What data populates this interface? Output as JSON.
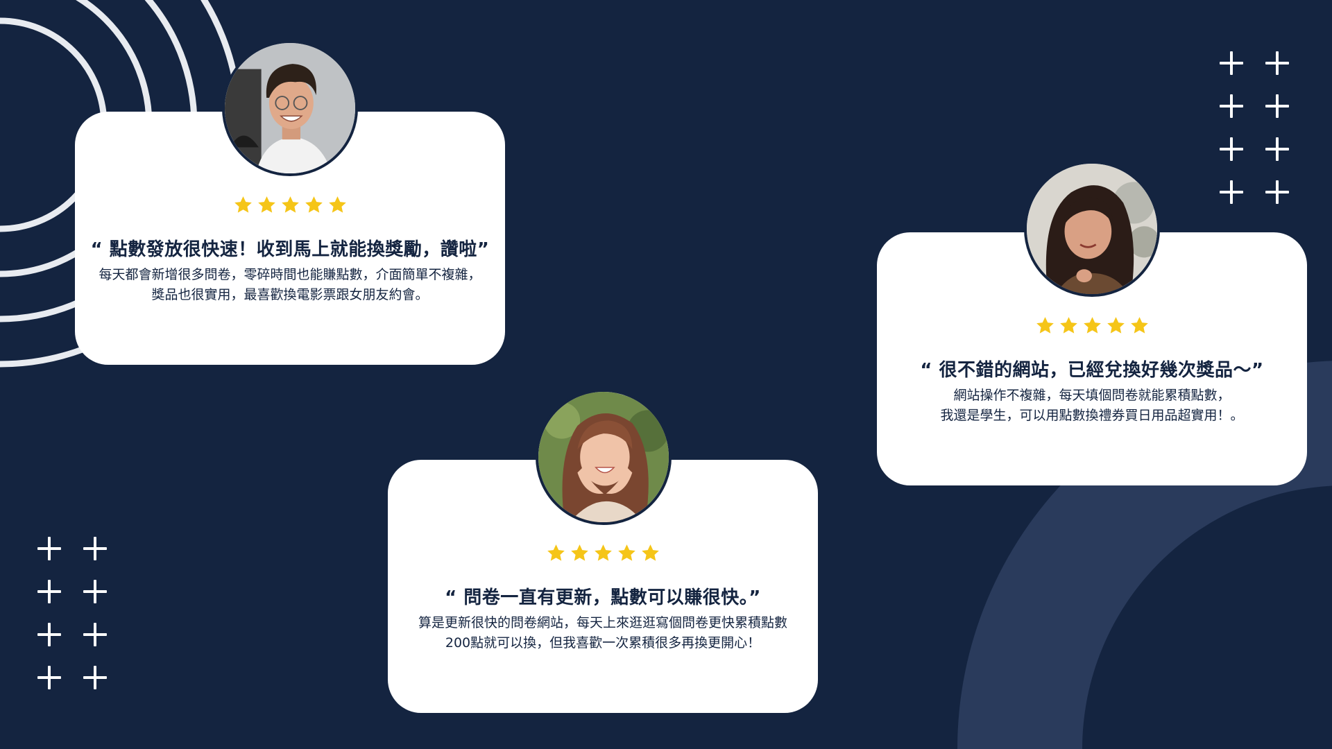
{
  "background_color": "#142440",
  "card_color": "#ffffff",
  "star_color": "#f5c518",
  "text_color": "#142440",
  "testimonials": [
    {
      "rating": 5,
      "quote": "“ 點數發放很快速！收到馬上就能換獎勵，讚啦”",
      "body_line1": "每天都會新增很多問卷，零碎時間也能賺點數，介面簡單不複雜，",
      "body_line2": "獎品也很實用，最喜歡換電影票跟女朋友約會。",
      "avatar": "smiling-man-with-glasses"
    },
    {
      "rating": 5,
      "quote": "“ 問卷一直有更新，點數可以賺很快。”",
      "body_line1": "算是更新很快的問卷網站，每天上來逛逛寫個問卷更快累積點數",
      "body_line2": "200點就可以換，但我喜歡一次累積很多再換更開心！",
      "avatar": "smiling-woman-hands-on-cheeks"
    },
    {
      "rating": 5,
      "quote": "“ 很不錯的網站，已經兌換好幾次獎品～”",
      "body_line1": "網站操作不複雜，每天填個問卷就能累積點數，",
      "body_line2": "我還是學生，可以用點數換禮券買日用品超實用！。",
      "avatar": "woman-making-finger-heart"
    }
  ]
}
